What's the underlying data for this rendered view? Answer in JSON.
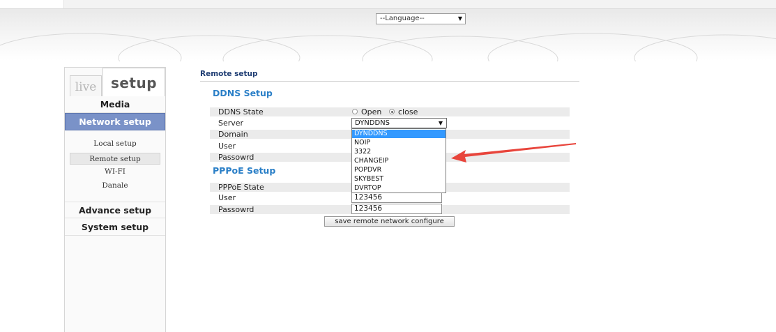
{
  "header": {
    "language_select": "--Language--"
  },
  "sidebar": {
    "tab_live": "live",
    "tab_setup": "setup",
    "main_items": [
      {
        "label": "Media"
      },
      {
        "label": "Network setup"
      },
      {
        "label": "Advance setup"
      },
      {
        "label": "System setup"
      }
    ],
    "sub_items": [
      {
        "label": "Local setup"
      },
      {
        "label": "Remote setup"
      },
      {
        "label": "WI-FI"
      },
      {
        "label": "Danale"
      }
    ]
  },
  "main": {
    "breadcrumb": "Remote setup",
    "ddns": {
      "title": "DDNS Setup",
      "state_label": "DDNS State",
      "option_open": "Open",
      "option_close": "close",
      "server_label": "Server",
      "server_value": "DYNDDNS",
      "domain_label": "Domain",
      "user_label": "User",
      "password_label": "Passowrd",
      "server_options": [
        "DYNDDNS",
        "NOIP",
        "3322",
        "CHANGEIP",
        "POPDVR",
        "SKYBEST",
        "DVRTOP"
      ]
    },
    "pppoe": {
      "title": "PPPoE Setup",
      "state_label": "PPPoE State",
      "user_label": "User",
      "user_value": "123456",
      "password_label": "Passowrd",
      "password_value": "123456"
    },
    "save_button": "save remote network configure"
  },
  "colors": {
    "active_nav": "#7a92c8",
    "section_title": "#2a7fc7",
    "dropdown_highlight": "#3399ff",
    "annotation_arrow": "#e8453c"
  }
}
